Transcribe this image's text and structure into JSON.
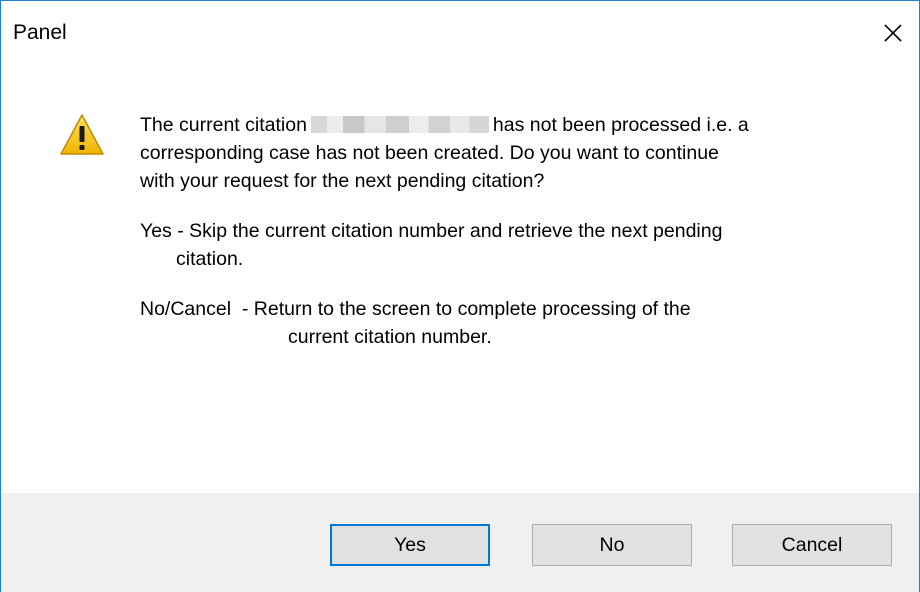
{
  "window": {
    "title": "Panel",
    "close_icon": "close-icon"
  },
  "message": {
    "icon": "warning-icon",
    "line1_prefix": "The current citation",
    "line1_suffix": "has not been processed i.e. a",
    "line2": "corresponding case has not been created. Do you want to continue",
    "line3": "with your request for the next pending citation?",
    "yes_line1": "Yes - Skip the current citation number and retrieve the next pending",
    "yes_line2": "citation.",
    "no_line1": "No/Cancel  - Return to the screen to complete processing of the",
    "no_line2": "current citation number."
  },
  "buttons": {
    "yes": "Yes",
    "no": "No",
    "cancel": "Cancel"
  },
  "colors": {
    "border_accent": "#1f7fd1",
    "footer_bg": "#f0f0f0",
    "button_bg": "#e1e1e1",
    "default_button_border": "#0078d7",
    "warning_yellow": "#f5c518"
  }
}
